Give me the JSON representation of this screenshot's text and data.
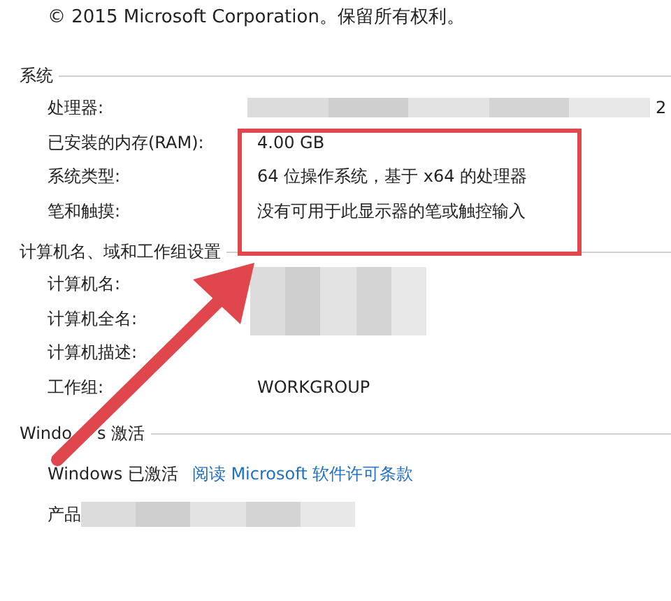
{
  "copyright": "© 2015 Microsoft Corporation。保留所有权利。",
  "sections": [
    {
      "title": "系统",
      "rows": [
        {
          "label": "处理器:",
          "redacted": true,
          "value": "2"
        },
        {
          "label": "已安装的内存(RAM):",
          "redacted": false,
          "value": "4.00 GB"
        },
        {
          "label": "系统类型:",
          "redacted": false,
          "value": "64 位操作系统，基于 x64 的处理器"
        },
        {
          "label": "笔和触摸:",
          "redacted": false,
          "value": "没有可用于此显示器的笔或触控输入"
        }
      ]
    },
    {
      "title": "计算机名、域和工作组设置",
      "rows": [
        {
          "label": "计算机名:",
          "redacted": true
        },
        {
          "label": "计算机全名:",
          "redacted": true
        },
        {
          "label": "计算机描述:",
          "redacted": false
        },
        {
          "label": "工作组:",
          "redacted": false,
          "value": "WORKGROUP"
        }
      ]
    },
    {
      "title": [
        "Windo",
        "s 激活"
      ],
      "activation": {
        "status": "Windows 已激活",
        "link": "阅读 Microsoft 软件许可条款",
        "product_label": "产品",
        "product_redacted": true
      }
    }
  ]
}
